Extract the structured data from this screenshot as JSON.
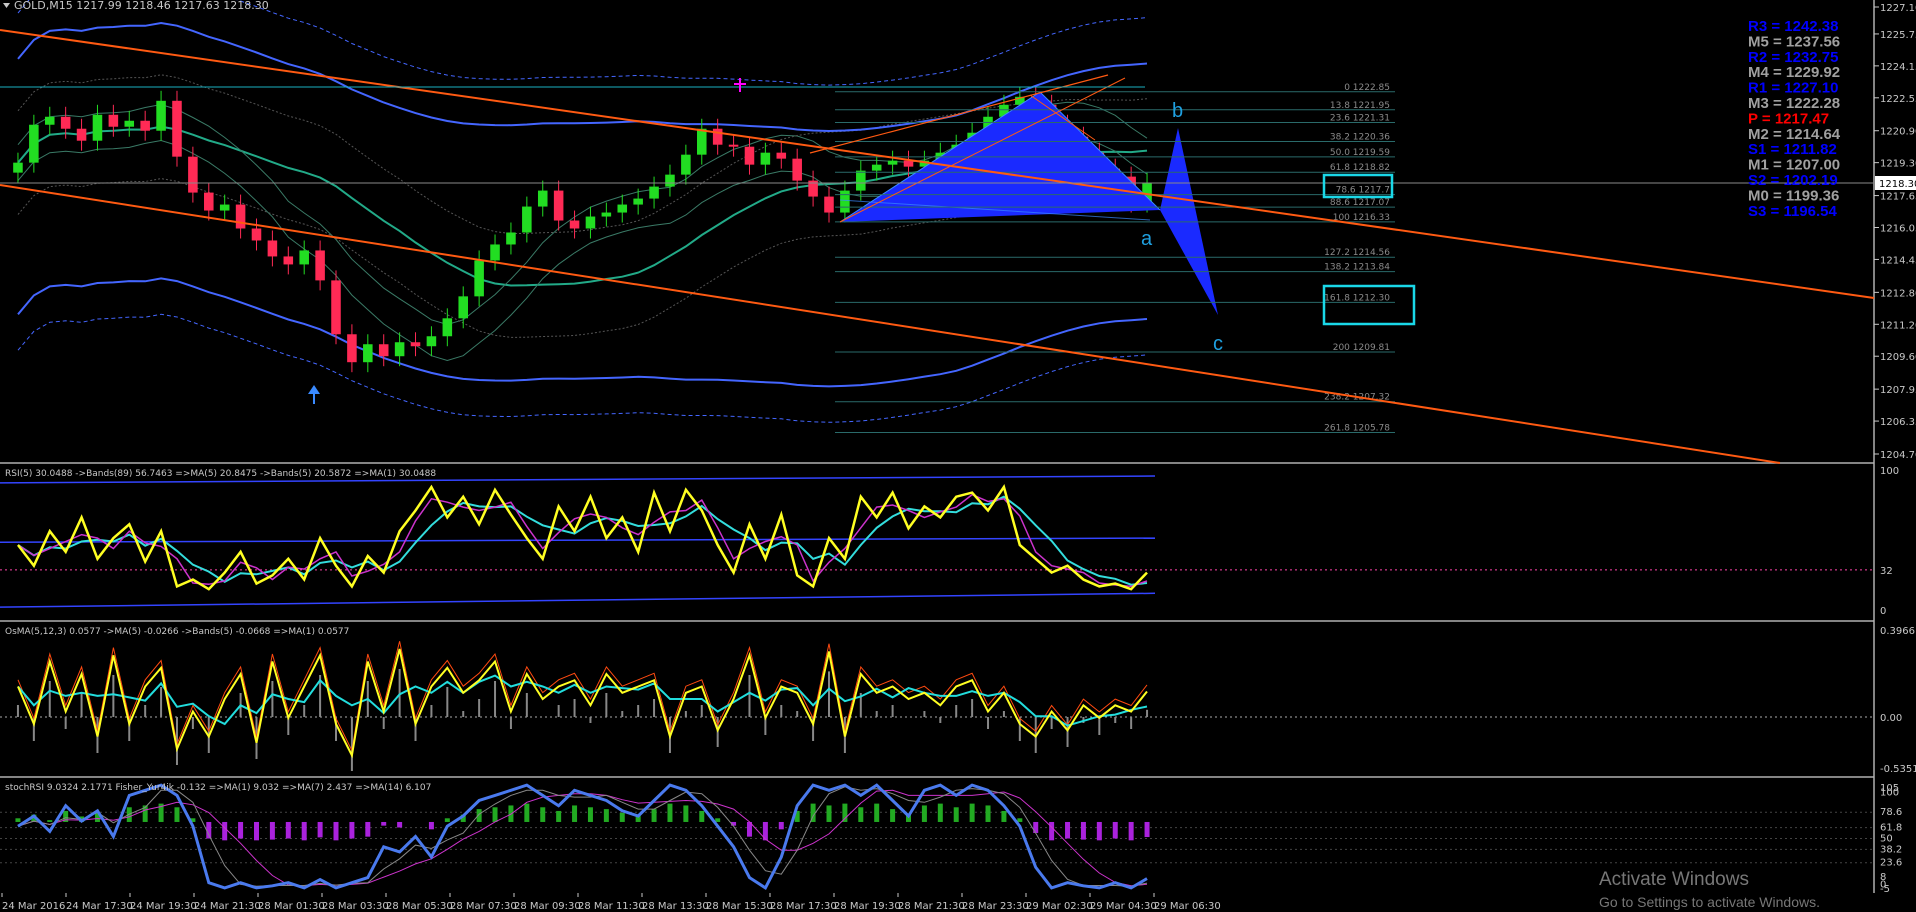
{
  "header": {
    "symbol": "GOLD,M15  1217.99 1218.46 1217.63 1218.30"
  },
  "pivots": [
    {
      "text": "R3 = 1242.38",
      "color": "#0000ff"
    },
    {
      "text": "M5 = 1237.56",
      "color": "#a0a0a0"
    },
    {
      "text": "R2 = 1232.75",
      "color": "#0000ff"
    },
    {
      "text": "M4 = 1229.92",
      "color": "#a0a0a0"
    },
    {
      "text": "R1 = 1227.10",
      "color": "#0000ff"
    },
    {
      "text": "M3 = 1222.28",
      "color": "#a0a0a0"
    },
    {
      "text": "P  = 1217.47",
      "color": "#ff0000"
    },
    {
      "text": "M2 = 1214.64",
      "color": "#a0a0a0"
    },
    {
      "text": "S1 = 1211.82",
      "color": "#0000ff"
    },
    {
      "text": "M1 = 1207.00",
      "color": "#a0a0a0"
    },
    {
      "text": "S2 = 1202.19",
      "color": "#0000ff"
    },
    {
      "text": "M0 = 1199.36",
      "color": "#a0a0a0"
    },
    {
      "text": "S3 = 1196.54",
      "color": "#0000ff"
    }
  ],
  "fib_levels": [
    "0 1222.85",
    "13.8 1221.95",
    "23.6 1221.31",
    "38.2 1220.36",
    "50.0 1219.59",
    "61.8 1218.82",
    "78.6 1217.7",
    "88.6 1217.07",
    "100 1216.33",
    "127.2 1214.56",
    "138.2 1213.84",
    "161.8 1212.30",
    "200 1209.81",
    "238.2 1207.32",
    "261.8 1205.78"
  ],
  "wave_labels": {
    "a": "a",
    "b": "b",
    "c": "c"
  },
  "price_axis": {
    "ticks": [
      "1227.10",
      "1225.75",
      "1224.15",
      "1222.55",
      "1220.90",
      "1219.30",
      "1217.65",
      "1216.05",
      "1214.45",
      "1212.80",
      "1211.20",
      "1209.60",
      "1207.95",
      "1206.35",
      "1204.70"
    ],
    "current": "1218.30"
  },
  "rsi_panel": {
    "title": "RSI(5) 30.0488  ->Bands(89) 56.7463  =>MA(5) 20.8475  ->Bands(5) 20.5872  =>MA(1) 30.0488",
    "ticks": [
      "100",
      "32",
      "0"
    ]
  },
  "osma_panel": {
    "title": "OsMA(5,12,3) 0.0577  ->MA(5) -0.0266  ->Bands(5) -0.0668  =>MA(1) 0.0577",
    "ticks": [
      "0.3966",
      "0.00",
      "-0.5351"
    ]
  },
  "stoch_panel": {
    "title": "stochRSI 9.0324 2.1771  Fisher_Yur4ik -0.132  =>MA(1) 9.032  =>MA(7) 2.437  =>MA(14) 6.107",
    "ticks": [
      "105",
      "100",
      "78.6",
      "61.8",
      "50",
      "38.2",
      "23.6",
      "8",
      "0",
      "-5"
    ]
  },
  "time_axis": [
    "24 Mar 2016",
    "24 Mar 17:30",
    "24 Mar 19:30",
    "24 Mar 21:30",
    "28 Mar 01:30",
    "28 Mar 03:30",
    "28 Mar 05:30",
    "28 Mar 07:30",
    "28 Mar 09:30",
    "28 Mar 11:30",
    "28 Mar 13:30",
    "28 Mar 15:30",
    "28 Mar 17:30",
    "28 Mar 19:30",
    "28 Mar 21:30",
    "28 Mar 23:30",
    "29 Mar 02:30",
    "29 Mar 04:30",
    "29 Mar 06:30"
  ],
  "watermark": {
    "line1": "Activate Windows",
    "line2": "Go to Settings to activate Windows."
  },
  "chart_data": {
    "type": "candlestick",
    "symbol": "GOLD",
    "timeframe": "M15",
    "ylim": [
      1204.7,
      1227.1
    ],
    "close_trace": [
      1219.3,
      1221.2,
      1221.6,
      1221.0,
      1220.4,
      1221.7,
      1221.1,
      1221.4,
      1220.9,
      1222.4,
      1219.6,
      1217.8,
      1216.9,
      1217.2,
      1216.0,
      1215.4,
      1214.6,
      1214.2,
      1214.9,
      1213.4,
      1210.7,
      1209.3,
      1210.2,
      1209.6,
      1210.3,
      1210.1,
      1210.6,
      1211.5,
      1212.6,
      1214.4,
      1215.2,
      1215.8,
      1217.1,
      1217.9,
      1216.4,
      1216.0,
      1216.6,
      1216.8,
      1217.2,
      1217.5,
      1218.1,
      1218.7,
      1219.7,
      1221.0,
      1220.2,
      1220.1,
      1219.2,
      1219.8,
      1219.5,
      1218.4,
      1217.6,
      1216.8,
      1217.9,
      1218.9,
      1219.2,
      1219.4,
      1219.1,
      1219.4,
      1219.8,
      1220.2,
      1220.8,
      1221.6,
      1222.2,
      1222.6,
      1222.2,
      1221.2,
      1220.6,
      1219.8,
      1219.0,
      1218.6,
      1217.3,
      1218.3
    ],
    "rsi_trace": [
      50,
      35,
      60,
      45,
      70,
      40,
      55,
      65,
      38,
      60,
      20,
      25,
      18,
      30,
      45,
      22,
      28,
      40,
      25,
      55,
      35,
      20,
      42,
      30,
      60,
      75,
      92,
      70,
      85,
      65,
      90,
      72,
      55,
      40,
      78,
      60,
      85,
      55,
      70,
      45,
      88,
      60,
      90,
      75,
      50,
      30,
      65,
      40,
      72,
      28,
      20,
      55,
      40,
      85,
      70,
      88,
      62,
      78,
      70,
      85,
      88,
      75,
      92,
      50,
      40,
      30,
      35,
      25,
      20,
      22,
      18,
      30
    ],
    "osma_trace": [
      0.1,
      -0.2,
      0.3,
      -0.1,
      0.2,
      -0.3,
      0.35,
      -0.2,
      0.1,
      0.25,
      -0.4,
      -0.1,
      -0.3,
      0.0,
      0.2,
      -0.35,
      0.3,
      -0.15,
      0.1,
      0.35,
      -0.2,
      -0.45,
      0.3,
      -0.1,
      0.4,
      -0.2,
      0.1,
      0.25,
      0.05,
      0.15,
      0.3,
      -0.1,
      0.2,
      0.0,
      0.1,
      0.15,
      -0.05,
      0.2,
      0.05,
      0.1,
      0.15,
      -0.3,
      0.05,
      0.1,
      -0.25,
      0.0,
      0.35,
      -0.15,
      0.1,
      0.05,
      -0.2,
      0.38,
      -0.3,
      0.2,
      0.05,
      0.1,
      0.0,
      0.05,
      -0.05,
      0.1,
      0.15,
      -0.1,
      0.05,
      -0.2,
      -0.3,
      -0.1,
      -0.25,
      -0.05,
      -0.15,
      -0.05,
      -0.1,
      0.06
    ],
    "stoch_trace": [
      60,
      70,
      55,
      80,
      65,
      75,
      50,
      90,
      95,
      100,
      90,
      60,
      5,
      0,
      5,
      0,
      2,
      5,
      0,
      8,
      0,
      5,
      10,
      40,
      35,
      50,
      30,
      60,
      70,
      85,
      90,
      95,
      100,
      90,
      80,
      95,
      90,
      85,
      75,
      70,
      85,
      100,
      95,
      80,
      60,
      40,
      10,
      0,
      30,
      80,
      100,
      95,
      100,
      90,
      100,
      85,
      70,
      95,
      100,
      90,
      100,
      95,
      80,
      60,
      20,
      0,
      5,
      2,
      0,
      5,
      0,
      9
    ],
    "fibonacci": [
      {
        "level": 0,
        "price": 1222.85
      },
      {
        "level": 13.8,
        "price": 1221.95
      },
      {
        "level": 23.6,
        "price": 1221.31
      },
      {
        "level": 38.2,
        "price": 1220.36
      },
      {
        "level": 50.0,
        "price": 1219.59
      },
      {
        "level": 61.8,
        "price": 1218.82
      },
      {
        "level": 78.6,
        "price": 1217.7
      },
      {
        "level": 88.6,
        "price": 1217.07
      },
      {
        "level": 100,
        "price": 1216.33
      },
      {
        "level": 127.2,
        "price": 1214.56
      },
      {
        "level": 138.2,
        "price": 1213.84
      },
      {
        "level": 161.8,
        "price": 1212.3
      },
      {
        "level": 200,
        "price": 1209.81
      },
      {
        "level": 238.2,
        "price": 1207.32
      },
      {
        "level": 261.8,
        "price": 1205.78
      }
    ],
    "pivot_points": {
      "R3": 1242.38,
      "M5": 1237.56,
      "R2": 1232.75,
      "M4": 1229.92,
      "R1": 1227.1,
      "M3": 1222.28,
      "P": 1217.47,
      "M2": 1214.64,
      "S1": 1211.82,
      "M1": 1207.0,
      "S2": 1202.19,
      "M0": 1199.36,
      "S3": 1196.54
    },
    "colors": {
      "bull": "#22dd22",
      "bear": "#ff2a55",
      "channel": "#ff5a12",
      "bands": "#4466ff",
      "ma": "#22aa88",
      "rsi": "#ffff22",
      "pattern": "#1a2aff"
    }
  }
}
